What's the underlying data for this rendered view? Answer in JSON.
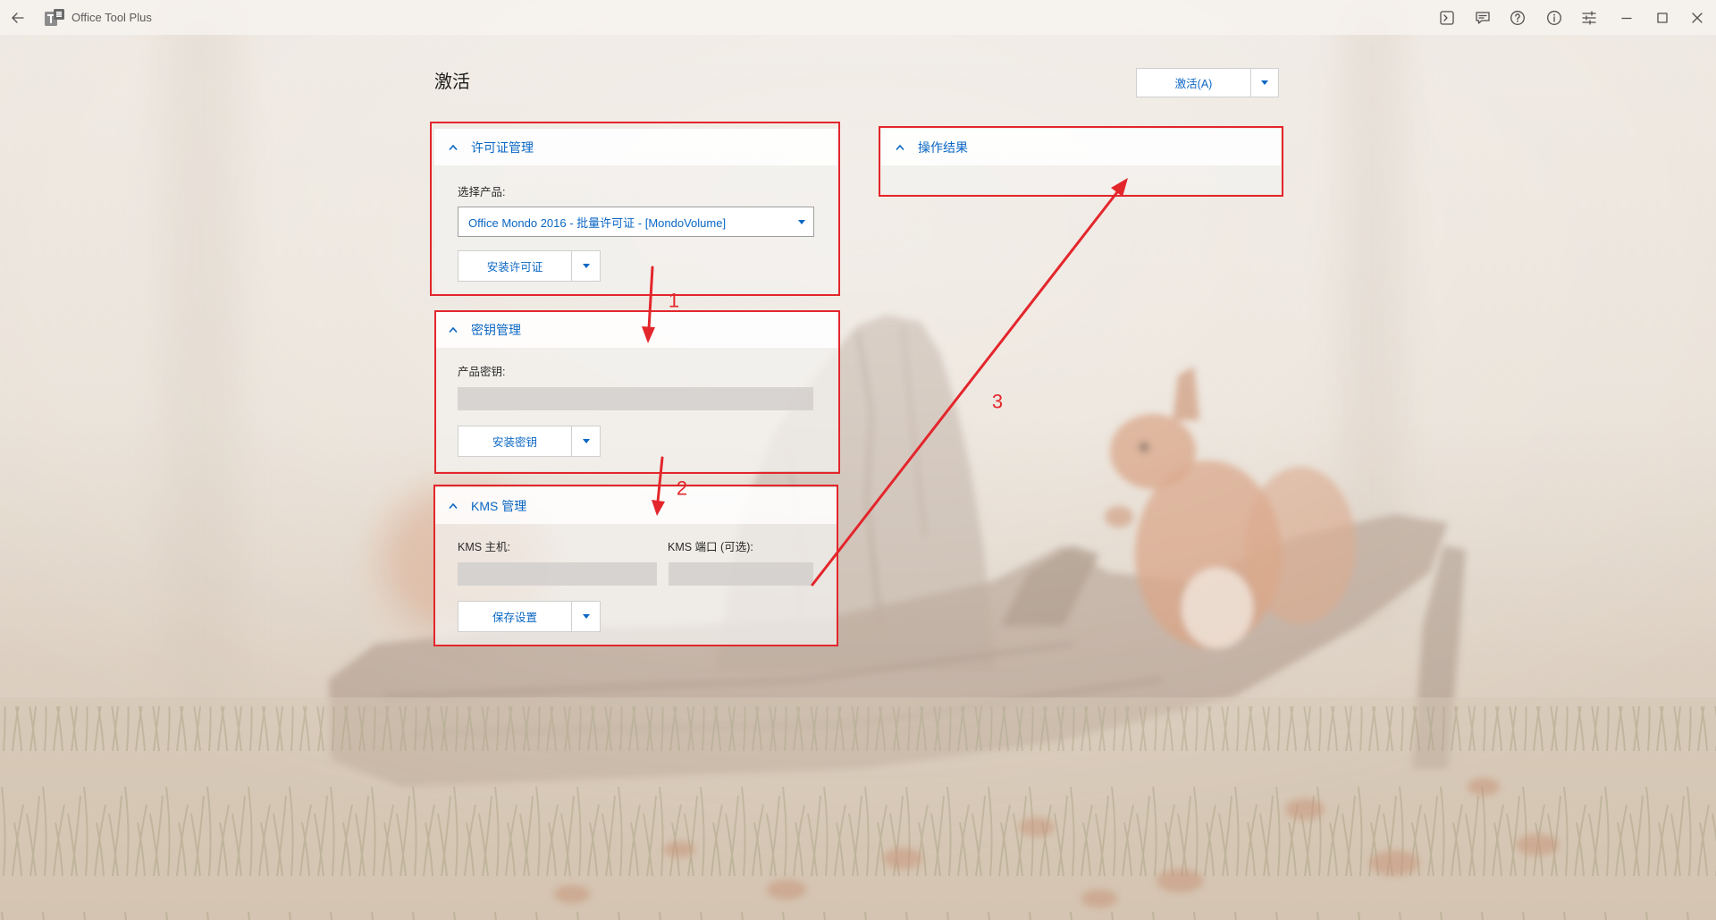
{
  "titlebar": {
    "back_icon": "arrow-left-icon",
    "app_icon": "office-tool-plus-logo-icon",
    "app_title": "Office Tool Plus",
    "action_icons": [
      "terminal-icon",
      "feedback-icon",
      "help-icon",
      "info-icon",
      "settings-sliders-icon"
    ],
    "window_icons": [
      "minimize-icon",
      "maximize-icon",
      "close-icon"
    ]
  },
  "page": {
    "title": "激活",
    "activate_button": "激活(A)",
    "dropdown_icon": "caret-down-icon"
  },
  "license_card": {
    "header": "许可证管理",
    "collapse_icon": "chevron-up-icon",
    "product_label": "选择产品:",
    "product_selected": "Office Mondo 2016 - 批量许可证 - [MondoVolume]",
    "install_button": "安装许可证"
  },
  "key_card": {
    "header": "密钥管理",
    "product_key_label": "产品密钥:",
    "product_key_value": "",
    "install_button": "安装密钥"
  },
  "kms_card": {
    "header": "KMS 管理",
    "host_label": "KMS 主机:",
    "host_value": "",
    "port_label": "KMS 端口 (可选):",
    "port_value": "",
    "save_button": "保存设置"
  },
  "result_card": {
    "header": "操作结果"
  },
  "annotations": {
    "step_labels": [
      "1",
      "2",
      "3"
    ]
  },
  "colors": {
    "accent": "#0b67c4",
    "annotation": "#e3262c",
    "card_header": "#fbfbfb",
    "input_fill": "#d2cfcc"
  }
}
